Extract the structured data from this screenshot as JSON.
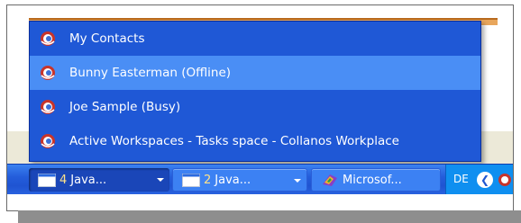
{
  "menu": {
    "items": [
      {
        "label": "My Contacts",
        "icon": "collanos-icon",
        "highlighted": false
      },
      {
        "label": "Bunny Easterman (Offline)",
        "icon": "collanos-icon",
        "highlighted": true
      },
      {
        "label": "Joe Sample (Busy)",
        "icon": "collanos-icon",
        "highlighted": false
      },
      {
        "label": "Active Workspaces - Tasks space - Collanos Workplace",
        "icon": "collanos-icon",
        "highlighted": false
      }
    ]
  },
  "taskbar": {
    "buttons": [
      {
        "count": "4",
        "label": "Java...",
        "icon": "window-icon",
        "state": "active"
      },
      {
        "count": "2",
        "label": "Java...",
        "icon": "window-icon",
        "state": "normal"
      },
      {
        "count": "",
        "label": "Microsof...",
        "icon": "visual-studio-icon",
        "state": "normal"
      }
    ],
    "tray": {
      "language": "DE",
      "expand_icon": "chevron-left-icon",
      "app_icon": "collanos-tray-icon"
    }
  },
  "colors": {
    "menu_bg": "#1f58d6",
    "menu_highlight": "#4a8ef5",
    "taskbar_bg": "#245ddb",
    "tray_bg": "#0f8ff0"
  }
}
